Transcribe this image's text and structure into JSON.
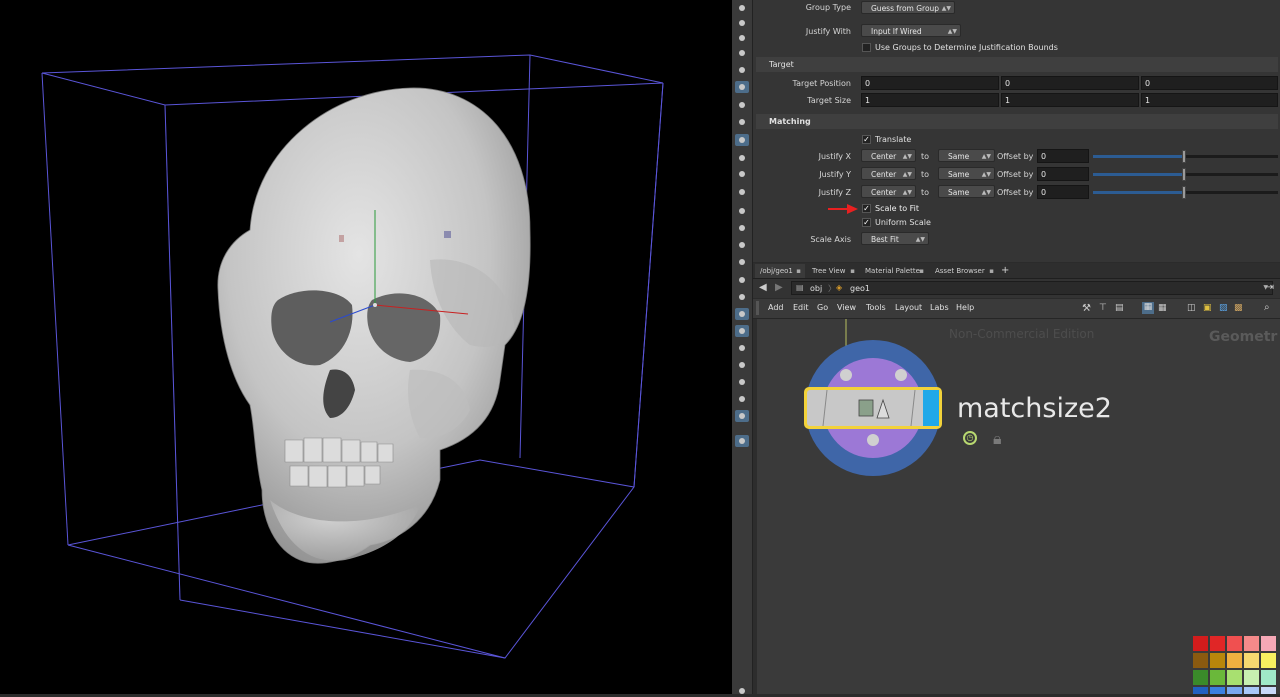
{
  "params": {
    "group_type": {
      "label": "Group Type",
      "value": "Guess from Group"
    },
    "justify_with": {
      "label": "Justify With",
      "value": "Input If Wired"
    },
    "use_groups": {
      "label": "Use Groups to Determine Justification Bounds"
    },
    "target": {
      "section": "Target",
      "position_label": "Target Position",
      "position": [
        "0",
        "0",
        "0"
      ],
      "size_label": "Target Size",
      "size": [
        "1",
        "1",
        "1"
      ]
    },
    "matching": {
      "section": "Matching",
      "translate_label": "Translate",
      "to": "to",
      "offset_by": "Offset by",
      "justify_x": {
        "label": "Justify X",
        "mode": "Center",
        "target": "Same",
        "offset": "0"
      },
      "justify_y": {
        "label": "Justify Y",
        "mode": "Center",
        "target": "Same",
        "offset": "0"
      },
      "justify_z": {
        "label": "Justify Z",
        "mode": "Center",
        "target": "Same",
        "offset": "0"
      },
      "scale_to_fit_label": "Scale to Fit",
      "uniform_scale_label": "Uniform Scale",
      "scale_axis": {
        "label": "Scale Axis",
        "value": "Best Fit"
      }
    }
  },
  "tabs": [
    "/obj/geo1",
    "Tree View",
    "Material Palette",
    "Asset Browser"
  ],
  "path": [
    "obj",
    "geo1"
  ],
  "menus": [
    "Add",
    "Edit",
    "Go",
    "View",
    "Tools",
    "Layout",
    "Labs",
    "Help"
  ],
  "network": {
    "watermark": "Non-Commercial Edition",
    "context_label": "Geometr",
    "node_name": "matchsize2"
  },
  "colors": {
    "viewport_bg": "#000000",
    "bbox_line": "#5a55d8",
    "node_outer": "#3f66a8",
    "node_inner": "#9c78d6",
    "node_selected": "#f2d23a",
    "node_flag": "#20a8e8",
    "annotation_arrow": "#e82020"
  },
  "palette": [
    [
      "#d21c1c",
      "#e02626",
      "#f05050",
      "#f58a8a",
      "#f6a8b6"
    ],
    [
      "#8a5a10",
      "#b8860b",
      "#f0b040",
      "#f6d870",
      "#f8f060"
    ],
    [
      "#3a8a2a",
      "#6ab83a",
      "#a8e070",
      "#c8f0b0",
      "#a0e8c8"
    ],
    [
      "#2060c0",
      "#3a80e0",
      "#78a8f0",
      "#a8c8f8",
      "#c8d8f8"
    ]
  ]
}
